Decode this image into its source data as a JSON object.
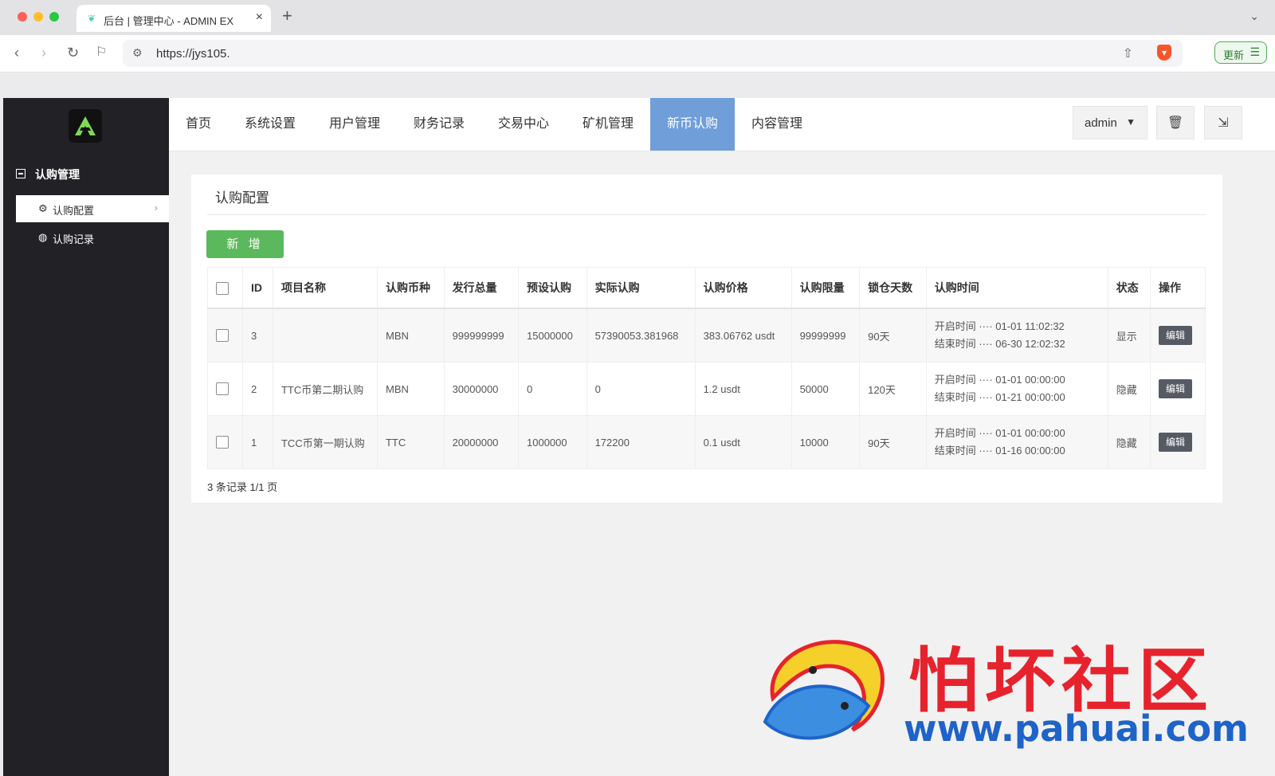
{
  "browser": {
    "tab_title": "后台 | 管理中心 - ADMIN EX",
    "url": "https://jys105.",
    "update_label": "更新"
  },
  "sidebar": {
    "group_label": "认购管理",
    "items": [
      {
        "label": "认购配置",
        "icon": "gear-icon",
        "active": true
      },
      {
        "label": "认购记录",
        "icon": "globe-icon",
        "active": false
      }
    ]
  },
  "topnav": {
    "items": [
      "首页",
      "系统设置",
      "用户管理",
      "财务记录",
      "交易中心",
      "矿机管理",
      "新币认购",
      "内容管理"
    ],
    "active_index": 6,
    "user_label": "admin"
  },
  "panel": {
    "title": "认购配置",
    "add_label": "新 增",
    "columns": [
      "ID",
      "项目名称",
      "认购币种",
      "发行总量",
      "预设认购",
      "实际认购",
      "认购价格",
      "认购限量",
      "锁仓天数",
      "认购时间",
      "状态",
      "操作"
    ],
    "rows": [
      {
        "id": "3",
        "name": "",
        "coin": "MBN",
        "total": "999999999",
        "preset": "15000000",
        "actual": "57390053.381968",
        "price": "383.06762 usdt",
        "limit": "99999999",
        "lock": "90天",
        "start": "开启时间 ···· 01-01 11:02:32",
        "end": "结束时间 ···· 06-30 12:02:32",
        "status": "显示",
        "action": "编辑"
      },
      {
        "id": "2",
        "name": "TTC币第二期认购",
        "coin": "MBN",
        "total": "30000000",
        "preset": "0",
        "actual": "0",
        "price": "1.2 usdt",
        "limit": "50000",
        "lock": "120天",
        "start": "开启时间 ···· 01-01 00:00:00",
        "end": "结束时间 ···· 01-21 00:00:00",
        "status": "隐藏",
        "action": "编辑"
      },
      {
        "id": "1",
        "name": "TCC币第一期认购",
        "coin": "TTC",
        "total": "20000000",
        "preset": "1000000",
        "actual": "172200",
        "price": "0.1 usdt",
        "limit": "10000",
        "lock": "90天",
        "start": "开启时间 ···· 01-01 00:00:00",
        "end": "结束时间 ···· 01-16 00:00:00",
        "status": "隐藏",
        "action": "编辑"
      }
    ],
    "footer": "3 条记录 1/1 页"
  },
  "watermark": {
    "title": "怕坏社区",
    "url": "www.pahuai.com"
  },
  "colors": {
    "sidebar_bg": "#222226",
    "nav_active": "#6f9ed9",
    "add_button": "#5cb85c",
    "edit_button": "#555a64"
  }
}
